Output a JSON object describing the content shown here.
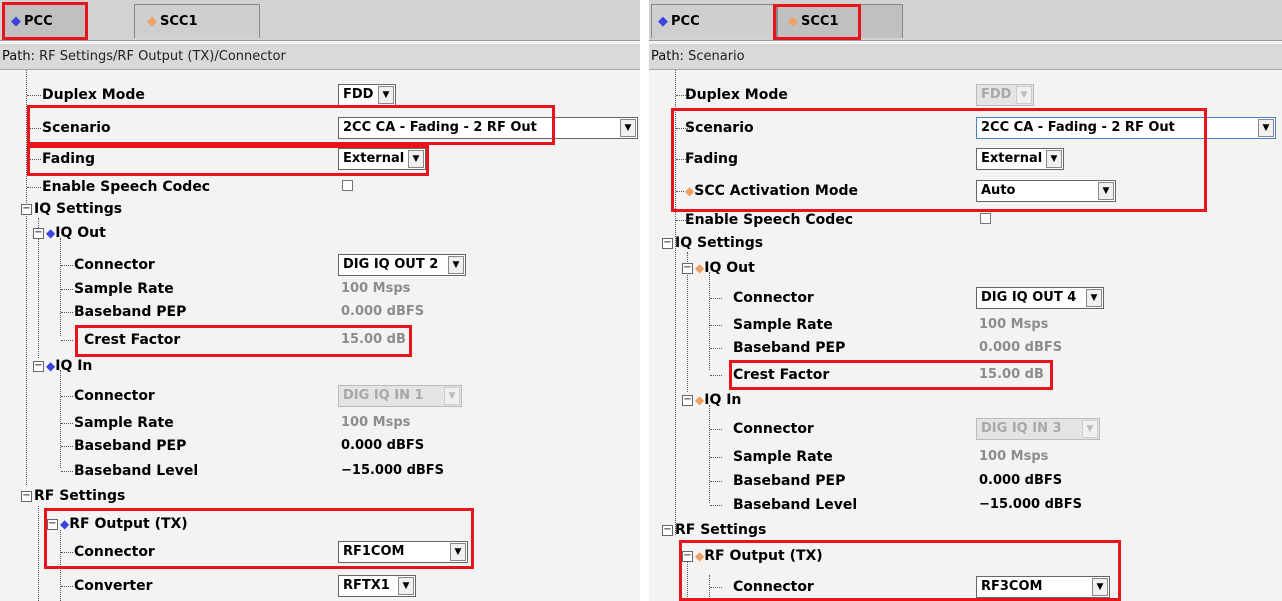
{
  "colors": {
    "pcc_diamond": "#3a44e0",
    "scc_diamond": "#f0a060",
    "highlight": "#e8141c",
    "disabled": "#8c8c8c"
  },
  "left": {
    "tabs": {
      "pcc": "PCC",
      "scc": "SCC1"
    },
    "path": {
      "label": "Path:",
      "value": "RF Settings/RF Output (TX)/Connector"
    },
    "rows": {
      "duplex_mode": "Duplex Mode",
      "duplex_value": "FDD",
      "scenario": "Scenario",
      "scenario_value": "2CC CA - Fading - 2 RF Out",
      "fading": "Fading",
      "fading_value": "External",
      "speech_codec": "Enable Speech Codec",
      "iq_settings": "IQ Settings",
      "iq_out": "IQ Out",
      "iq_out_connector": "Connector",
      "iq_out_connector_value": "DIG IQ OUT 2",
      "iq_out_sample_rate": "Sample Rate",
      "iq_out_sample_rate_value": "100 Msps",
      "iq_out_pep": "Baseband PEP",
      "iq_out_pep_value": "0.000 dBFS",
      "iq_out_crest": "Crest Factor",
      "iq_out_crest_value": "15.00 dB",
      "iq_in": "IQ In",
      "iq_in_connector": "Connector",
      "iq_in_connector_value": "DIG IQ IN 1",
      "iq_in_sample_rate": "Sample Rate",
      "iq_in_sample_rate_value": "100 Msps",
      "iq_in_pep": "Baseband PEP",
      "iq_in_pep_value": "0.000 dBFS",
      "iq_in_level": "Baseband Level",
      "iq_in_level_value": "−15.000 dBFS",
      "rf_settings": "RF Settings",
      "rf_output": "RF Output (TX)",
      "rf_connector": "Connector",
      "rf_connector_value": "RF1COM",
      "rf_converter": "Converter",
      "rf_converter_value": "RFTX1"
    }
  },
  "right": {
    "tabs": {
      "pcc": "PCC",
      "scc": "SCC1"
    },
    "path": {
      "label": "Path:",
      "value": "Scenario"
    },
    "rows": {
      "duplex_mode": "Duplex Mode",
      "duplex_value": "FDD",
      "scenario": "Scenario",
      "scenario_value": "2CC CA - Fading - 2 RF Out",
      "fading": "Fading",
      "fading_value": "External",
      "scc_activation": "SCC Activation Mode",
      "scc_activation_value": "Auto",
      "speech_codec": "Enable Speech Codec",
      "iq_settings": "IQ Settings",
      "iq_out": "IQ Out",
      "iq_out_connector": "Connector",
      "iq_out_connector_value": "DIG IQ OUT 4",
      "iq_out_sample_rate": "Sample Rate",
      "iq_out_sample_rate_value": "100 Msps",
      "iq_out_pep": "Baseband PEP",
      "iq_out_pep_value": "0.000 dBFS",
      "iq_out_crest": "Crest Factor",
      "iq_out_crest_value": "15.00 dB",
      "iq_in": "IQ In",
      "iq_in_connector": "Connector",
      "iq_in_connector_value": "DIG IQ IN 3",
      "iq_in_sample_rate": "Sample Rate",
      "iq_in_sample_rate_value": "100 Msps",
      "iq_in_pep": "Baseband PEP",
      "iq_in_pep_value": "0.000 dBFS",
      "iq_in_level": "Baseband Level",
      "iq_in_level_value": "−15.000 dBFS",
      "rf_settings": "RF Settings",
      "rf_output": "RF Output (TX)",
      "rf_connector": "Connector",
      "rf_connector_value": "RF3COM"
    }
  }
}
